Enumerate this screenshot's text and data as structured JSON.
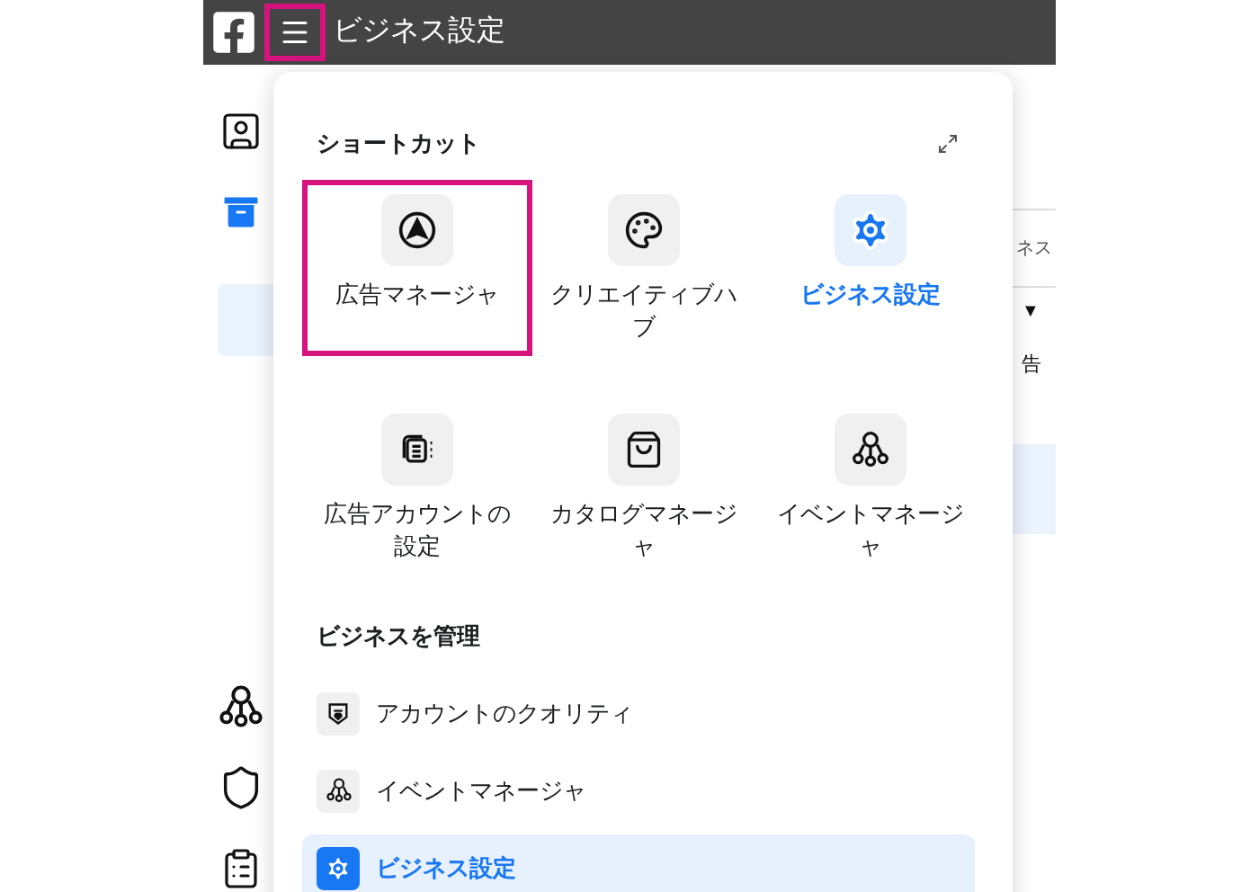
{
  "top_bar": {
    "title": "ビジネス設定",
    "menu_button": {
      "annotated": true
    }
  },
  "background_page": {
    "field_text": "ネス",
    "caret": "▼",
    "label": "告"
  },
  "sidebar": {
    "items": [
      {
        "kind": "id-card",
        "selected": false
      },
      {
        "kind": "archive",
        "selected": false
      },
      {
        "kind": "blank",
        "selected": true
      },
      {
        "kind": "nodes",
        "selected": false
      },
      {
        "kind": "shield",
        "selected": false
      },
      {
        "kind": "clipboard",
        "selected": false
      }
    ]
  },
  "shortcuts": {
    "title": "ショートカット",
    "items": [
      {
        "kind": "ads",
        "label": "広告マネージャ",
        "selected": false,
        "annotated": true
      },
      {
        "kind": "palette",
        "label": "クリエイティブハブ",
        "selected": false,
        "annotated": false
      },
      {
        "kind": "settings",
        "label": "ビジネス設定",
        "selected": true,
        "annotated": false
      },
      {
        "kind": "account",
        "label": "広告アカウントの設定",
        "selected": false,
        "annotated": false
      },
      {
        "kind": "catalog",
        "label": "カタログマネージャ",
        "selected": false,
        "annotated": false
      },
      {
        "kind": "nodes",
        "label": "イベントマネージャ",
        "selected": false,
        "annotated": false
      }
    ]
  },
  "manage": {
    "title": "ビジネスを管理",
    "items": [
      {
        "kind": "quality",
        "label": "アカウントのクオリティ",
        "selected": false
      },
      {
        "kind": "nodes",
        "label": "イベントマネージャ",
        "selected": false
      },
      {
        "kind": "settings",
        "label": "ビジネス設定",
        "selected": true
      }
    ]
  }
}
